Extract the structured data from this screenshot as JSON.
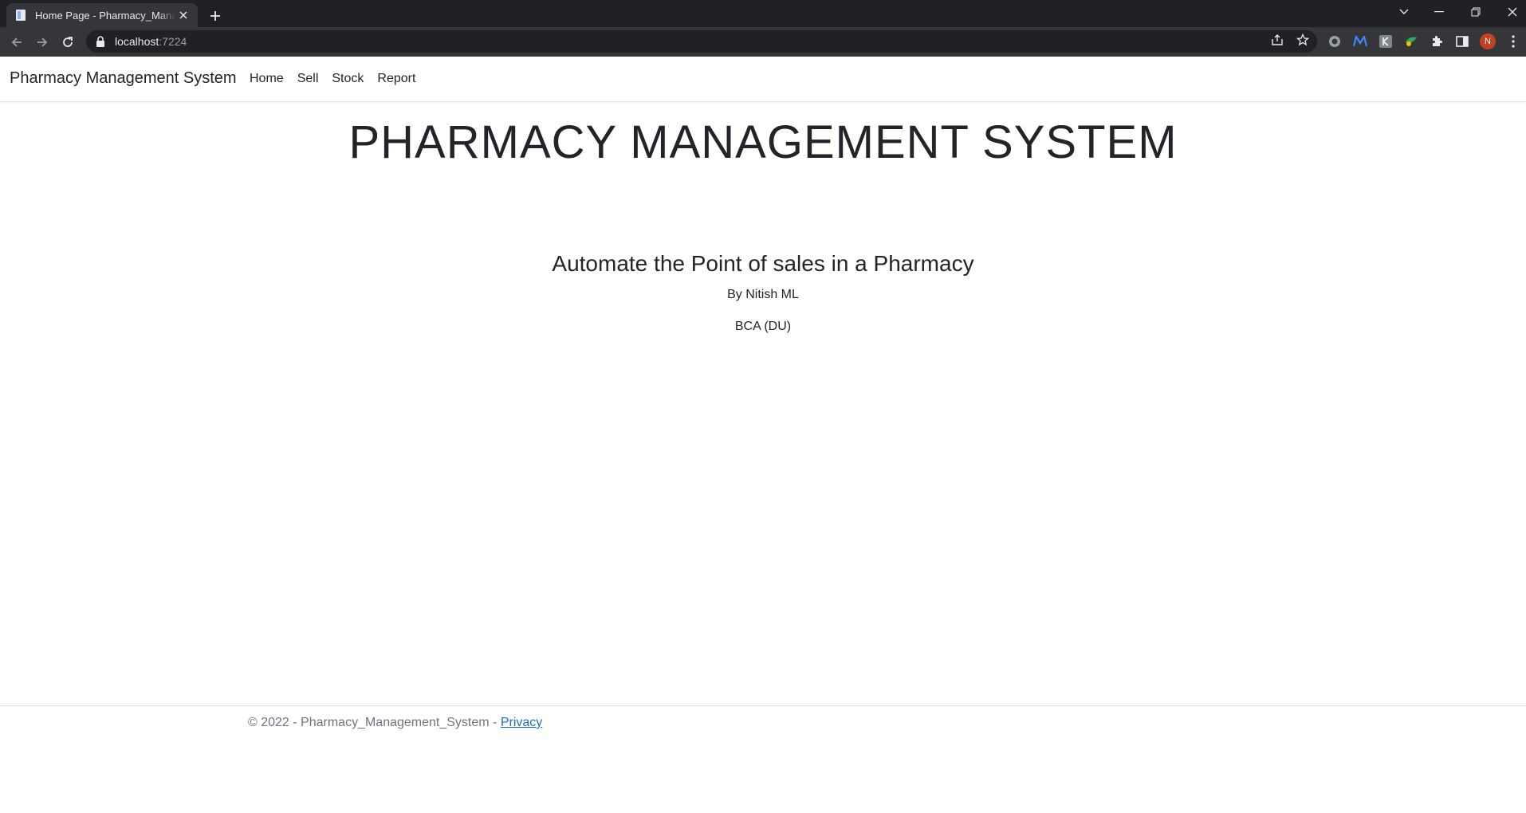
{
  "browser": {
    "tab_title": "Home Page - Pharmacy_Management_System",
    "url_host": "localhost",
    "url_port": ":7224",
    "profile_initial": "N",
    "icons": {
      "back": "arrow-left-icon",
      "forward": "arrow-right-icon",
      "reload": "reload-icon",
      "share": "share-icon",
      "bookmark": "star-icon",
      "extensions": [
        "grammarly-icon",
        "m-extension-icon",
        "k-extension-icon",
        "green-extension-icon",
        "puzzle-icon",
        "side-panel-icon"
      ],
      "menu": "kebab-menu-icon"
    }
  },
  "navbar": {
    "brand": "Pharmacy Management System",
    "links": [
      {
        "label": "Home"
      },
      {
        "label": "Sell"
      },
      {
        "label": "Stock"
      },
      {
        "label": "Report"
      }
    ]
  },
  "main": {
    "title": "PHARMACY MANAGEMENT SYSTEM",
    "subtitle": "Automate the Point of sales in a Pharmacy",
    "author": "By Nitish ML",
    "degree": "BCA (DU)"
  },
  "footer": {
    "text": "© 2022 - Pharmacy_Management_System - ",
    "link": "Privacy"
  },
  "colors": {
    "chrome_dark": "#202124",
    "chrome_toolbar": "#35363a",
    "text": "#212529",
    "muted": "#6c757d",
    "link": "#1b6ec2",
    "avatar": "#c5401f"
  }
}
